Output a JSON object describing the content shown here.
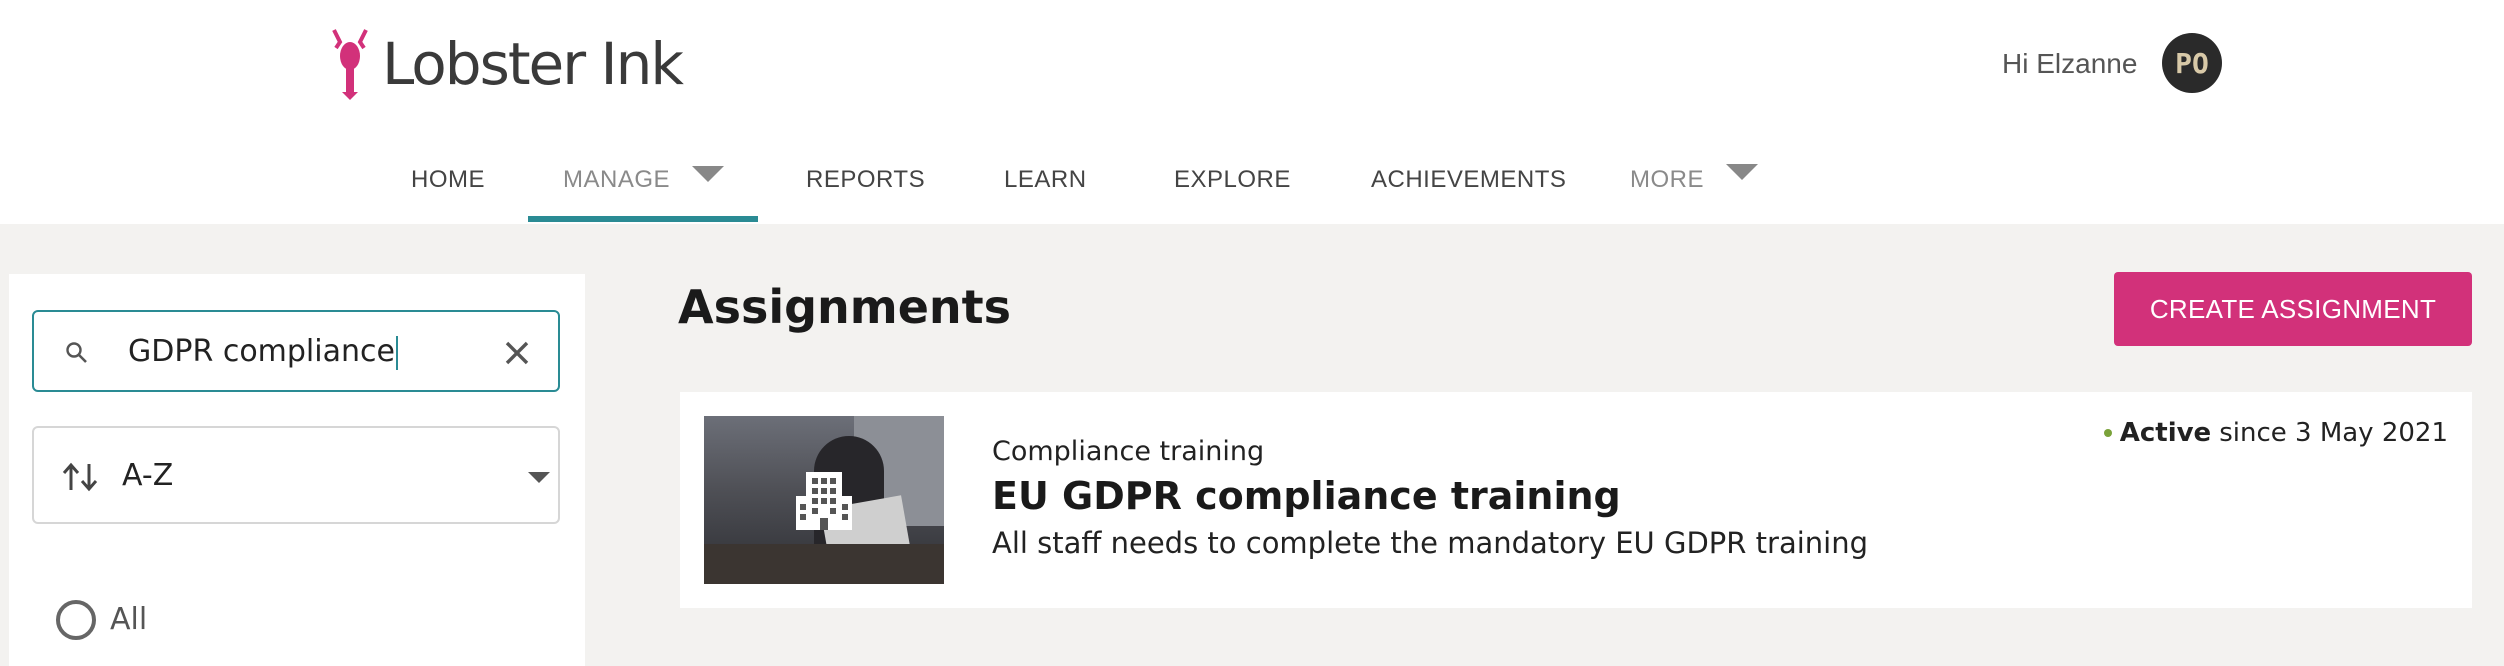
{
  "brand": {
    "name": "Lobster Ink",
    "accent": "#d2317a",
    "teal": "#2a8b94"
  },
  "user": {
    "greeting": "Hi Elzanne",
    "initials": "PO"
  },
  "nav": {
    "home": "HOME",
    "manage": "MANAGE",
    "reports": "REPORTS",
    "learn": "LEARN",
    "explore": "EXPLORE",
    "achievements": "ACHIEVEMENTS",
    "more": "MORE",
    "active": "MANAGE"
  },
  "filters": {
    "search_value": "GDPR compliance",
    "sort_value": "A-Z",
    "radio_all": "All"
  },
  "main": {
    "title": "Assignments",
    "create_button": "CREATE ASSIGNMENT"
  },
  "assignments": [
    {
      "category": "Compliance training",
      "title": "EU GDPR compliance training",
      "description": "All staff needs to complete the mandatory EU GDPR training",
      "status": "Active",
      "since": "since 3 May 2021",
      "status_color": "#7aa23a"
    }
  ]
}
